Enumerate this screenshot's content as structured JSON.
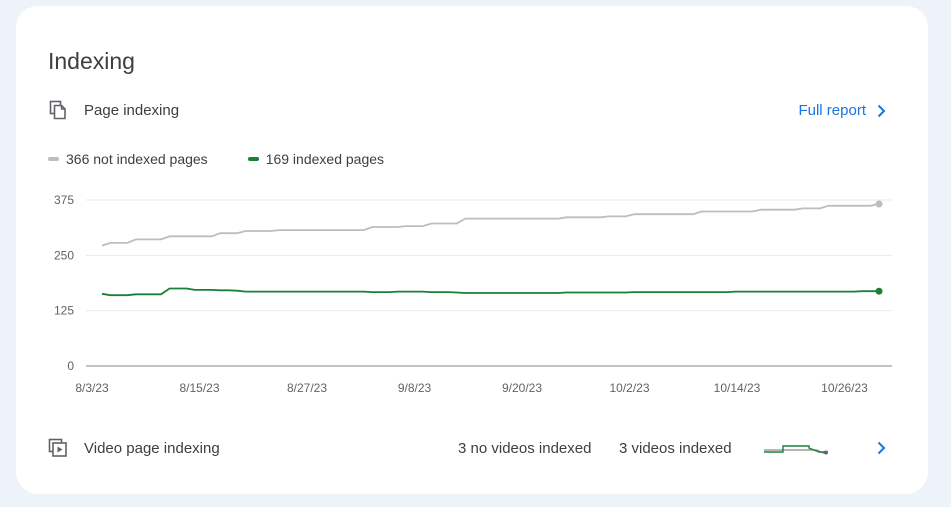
{
  "card": {
    "title": "Indexing"
  },
  "page_indexing": {
    "label": "Page indexing",
    "full_report": "Full report"
  },
  "legend": {
    "not_indexed": "366 not indexed pages",
    "indexed": "169 indexed pages"
  },
  "colors": {
    "not_indexed": "#bdbdbd",
    "indexed": "#188038",
    "link": "#1a73e8"
  },
  "chart_data": {
    "type": "line",
    "x": [
      "8/3/23",
      "8/15/23",
      "8/27/23",
      "9/8/23",
      "9/20/23",
      "10/2/23",
      "10/14/23",
      "10/26/23"
    ],
    "yticks": [
      0,
      125,
      250,
      375
    ],
    "ylim": [
      0,
      400
    ],
    "grid": true,
    "legend_position": "top-left",
    "series": [
      {
        "name": "366 not indexed pages",
        "color": "#bdbdbd",
        "values": [
          272,
          278,
          278,
          278,
          286,
          286,
          286,
          286,
          293,
          293,
          293,
          293,
          293,
          293,
          300,
          300,
          300,
          305,
          305,
          305,
          305,
          307,
          307,
          307,
          307,
          307,
          307,
          307,
          307,
          307,
          307,
          307,
          314,
          314,
          314,
          314,
          316,
          316,
          316,
          322,
          322,
          322,
          322,
          333,
          333,
          333,
          333,
          333,
          333,
          333,
          333,
          333,
          333,
          333,
          333,
          336,
          336,
          336,
          336,
          336,
          338,
          338,
          338,
          343,
          343,
          343,
          343,
          343,
          343,
          343,
          343,
          349,
          349,
          349,
          349,
          349,
          349,
          349,
          353,
          353,
          353,
          353,
          353,
          356,
          356,
          356,
          362,
          362,
          362,
          362,
          362,
          362,
          366
        ]
      },
      {
        "name": "169 indexed pages",
        "color": "#188038",
        "values": [
          163,
          160,
          160,
          160,
          162,
          162,
          162,
          162,
          175,
          175,
          175,
          172,
          172,
          172,
          171,
          171,
          170,
          168,
          168,
          168,
          168,
          168,
          168,
          168,
          168,
          168,
          168,
          168,
          168,
          168,
          168,
          168,
          167,
          167,
          167,
          168,
          168,
          168,
          168,
          167,
          167,
          167,
          166,
          165,
          165,
          165,
          165,
          165,
          165,
          165,
          165,
          165,
          165,
          165,
          165,
          166,
          166,
          166,
          166,
          166,
          166,
          166,
          166,
          167,
          167,
          167,
          167,
          167,
          167,
          167,
          167,
          167,
          167,
          167,
          167,
          168,
          168,
          168,
          168,
          168,
          168,
          168,
          168,
          168,
          168,
          168,
          168,
          168,
          168,
          168,
          169,
          169,
          169
        ]
      }
    ]
  },
  "video_indexing": {
    "label": "Video page indexing",
    "not_indexed": "3 no videos indexed",
    "indexed": "3 videos indexed"
  }
}
